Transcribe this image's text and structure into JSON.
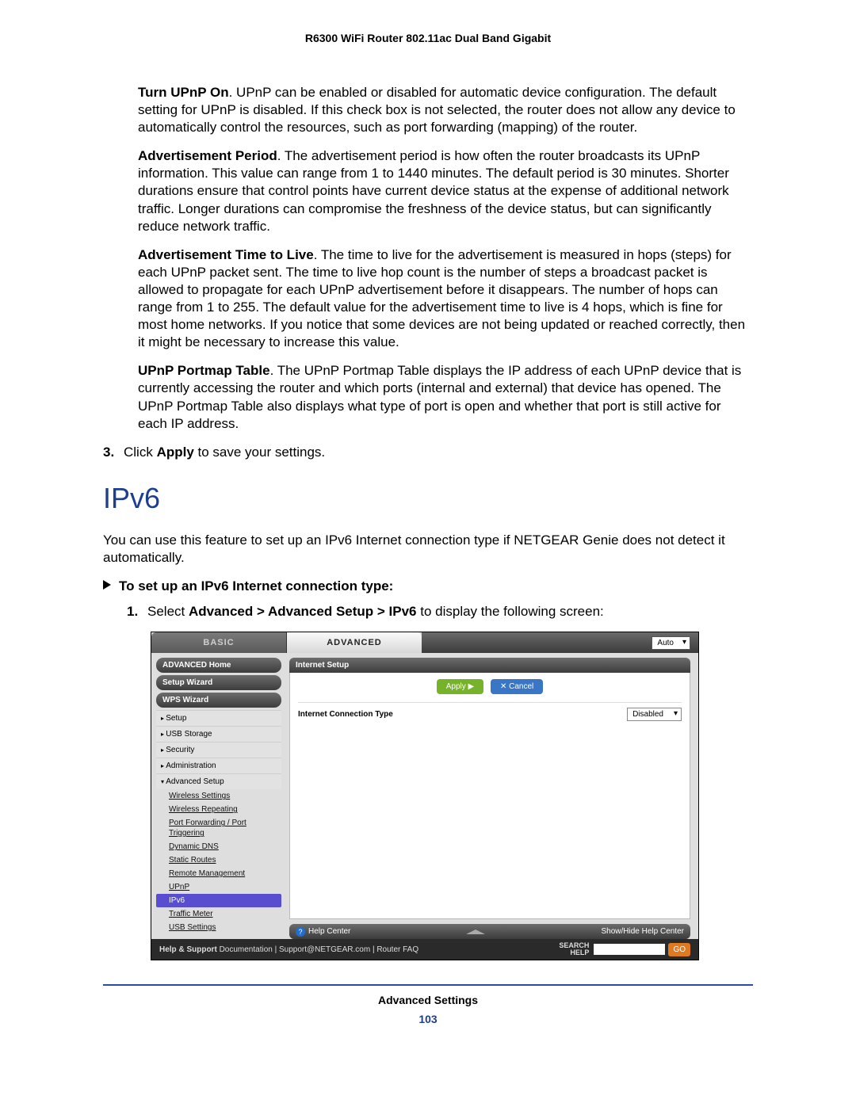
{
  "doc_header": "R6300 WiFi Router 802.11ac Dual Band Gigabit",
  "paragraphs": {
    "upnp_lead": "Turn UPnP On",
    "upnp": ". UPnP can be enabled or disabled for automatic device configuration. The default setting for UPnP is disabled. If this check box is not selected, the router does not allow any device to automatically control the resources, such as port forwarding (mapping) of the router.",
    "adv_period_lead": "Advertisement Period",
    "adv_period": ". The advertisement period is how often the router broadcasts its UPnP information. This value can range from 1 to 1440 minutes. The default period is 30 minutes. Shorter durations ensure that control points have current device status at the expense of additional network traffic. Longer durations can compromise the freshness of the device status, but can significantly reduce network traffic.",
    "ttl_lead": "Advertisement Time to Live",
    "ttl": ". The time to live for the advertisement is measured in hops (steps) for each UPnP packet sent. The time to live hop count is the number of steps a broadcast packet is allowed to propagate for each UPnP advertisement before it disappears. The number of hops can range from 1 to 255. The default value for the advertisement time to live is 4 hops, which is fine for most home networks. If you notice that some devices are not being updated or reached correctly, then it might be necessary to increase this value.",
    "portmap_lead": "UPnP Portmap Table",
    "portmap": ". The UPnP Portmap Table displays the IP address of each UPnP device that is currently accessing the router and which ports (internal and external) that device has opened. The UPnP Portmap Table also displays what type of port is open and whether that port is still active for each IP address."
  },
  "step3_num": "3.",
  "step3_a": "Click ",
  "step3_b": "Apply",
  "step3_c": " to save your settings.",
  "ipv6_heading": "IPv6",
  "ipv6_intro": "You can use this feature to set up an IPv6 Internet connection type if NETGEAR Genie does not detect it automatically.",
  "proc_heading": "To set up an IPv6 Internet connection type:",
  "sub1_num": "1.",
  "sub1_a": "Select ",
  "sub1_b": "Advanced > Advanced Setup > IPv6",
  "sub1_c": " to display the following screen:",
  "ui": {
    "tab_basic": "BASIC",
    "tab_advanced": "ADVANCED",
    "auto": "Auto",
    "sidebar": {
      "home": "ADVANCED Home",
      "setup_wizard": "Setup Wizard",
      "wps_wizard": "WPS Wizard",
      "setup": "Setup",
      "usb": "USB Storage",
      "security": "Security",
      "admin": "Administration",
      "adv_setup": "Advanced Setup",
      "subs": {
        "wireless": "Wireless Settings",
        "repeating": "Wireless Repeating",
        "portfwd": "Port Forwarding / Port Triggering",
        "ddns": "Dynamic DNS",
        "static": "Static Routes",
        "remote": "Remote Management",
        "upnp": "UPnP",
        "ipv6": "IPv6",
        "traffic": "Traffic Meter",
        "usbset": "USB Settings"
      }
    },
    "panel_title": "Internet Setup",
    "apply": "Apply ▶",
    "cancel": "✕ Cancel",
    "conn_label": "Internet Connection Type",
    "conn_value": "Disabled",
    "help_center": "Help Center",
    "show_hide": "Show/Hide Help Center",
    "support_lead": "Help & Support ",
    "support_links": "Documentation  |  Support@NETGEAR.com  |  Router FAQ",
    "search_label1": "SEARCH",
    "search_label2": "HELP",
    "go": "GO"
  },
  "footer_label": "Advanced Settings",
  "page_number": "103"
}
